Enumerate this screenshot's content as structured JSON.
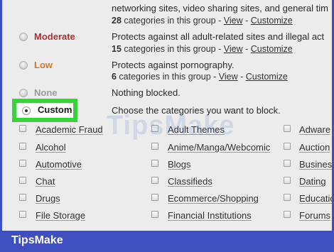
{
  "top_partial": {
    "desc": "networking sites, video sharing sites, and general tim",
    "count": "28",
    "count_suffix": " categories in this group - ",
    "view": "View",
    "sep": " - ",
    "customize": "Customize"
  },
  "levels": {
    "moderate": {
      "name": "Moderate",
      "color": "#a83232",
      "desc": "Protects against all adult-related sites and illegal act",
      "count": "15",
      "count_suffix": " categories in this group - ",
      "view": "View",
      "sep": " - ",
      "customize": "Customize"
    },
    "low": {
      "name": "Low",
      "color": "#d0772b",
      "desc": "Protects against pornography.",
      "count": "6",
      "count_suffix": " categories in this group - ",
      "view": "View",
      "sep": " - ",
      "customize": "Customize"
    },
    "none": {
      "name": "None",
      "color": "#9a9a9a",
      "desc": "Nothing blocked."
    },
    "custom": {
      "name": "Custom",
      "desc": "Choose the categories you want to block.",
      "highlight_color": "#3ad23a"
    }
  },
  "categories": {
    "col1": [
      "Academic Fraud",
      "Alcohol",
      "Automotive",
      "Chat",
      "Drugs",
      "File Storage"
    ],
    "col2": [
      "Adult Themes",
      "Anime/Manga/Webcomic",
      "Blogs",
      "Classifieds",
      "Ecommerce/Shopping",
      "Financial Institutions"
    ],
    "col3": [
      "Adware",
      "Auction",
      "Business",
      "Dating",
      "Educatio",
      "Forums"
    ]
  },
  "watermark": "TipsMake",
  "footer": {
    "logo": "TipsMake",
    "bar_color": "#3f4fbf"
  }
}
